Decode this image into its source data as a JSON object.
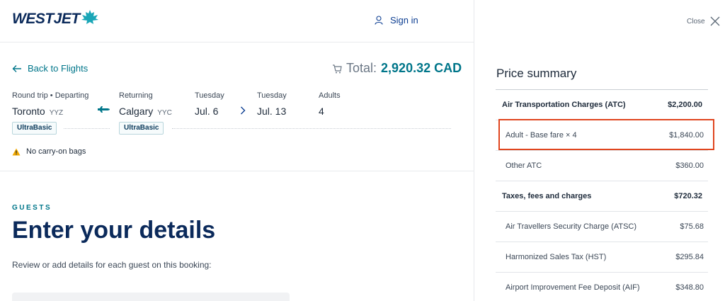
{
  "brand": {
    "name": "WESTJET",
    "accent": "#00768a",
    "navy": "#0b2a5b"
  },
  "header": {
    "signin_label": "Sign in",
    "signin_icon": "user-icon"
  },
  "booking": {
    "back_label": "Back to Flights",
    "total_label": "Total:",
    "total_amount": "2,920.32 CAD",
    "trip_type": "Round trip • Departing",
    "origin_city": "Toronto",
    "origin_code": "YYZ",
    "returning_label": "Returning",
    "destination_city": "Calgary",
    "destination_code": "YYC",
    "depart_day": "Tuesday",
    "depart_date": "Jul. 6",
    "return_day": "Tuesday",
    "return_date": "Jul. 13",
    "adults_label": "Adults",
    "adults_count": "4",
    "depart_fare": "UltraBasic",
    "return_fare": "UltraBasic",
    "warning": "No carry-on bags"
  },
  "guests": {
    "eyebrow": "GUESTS",
    "title": "Enter your details",
    "subtitle": "Review or add details for each guest on this booking:"
  },
  "price_summary": {
    "close_label": "Close",
    "title": "Price summary",
    "rows": [
      {
        "label": "Air Transportation Charges (ATC)",
        "amount": "$2,200.00",
        "kind": "head"
      },
      {
        "label": "Adult - Base fare × 4",
        "amount": "$1,840.00",
        "kind": "item"
      },
      {
        "label": "Other ATC",
        "amount": "$360.00",
        "kind": "item"
      },
      {
        "label": "Taxes, fees and charges",
        "amount": "$720.32",
        "kind": "head"
      },
      {
        "label": "Air Travellers Security Charge (ATSC)",
        "amount": "$75.68",
        "kind": "item"
      },
      {
        "label": "Harmonized Sales Tax (HST)",
        "amount": "$295.84",
        "kind": "item"
      },
      {
        "label": "Airport Improvement Fee Deposit (AIF)",
        "amount": "$348.80",
        "kind": "item"
      }
    ]
  }
}
